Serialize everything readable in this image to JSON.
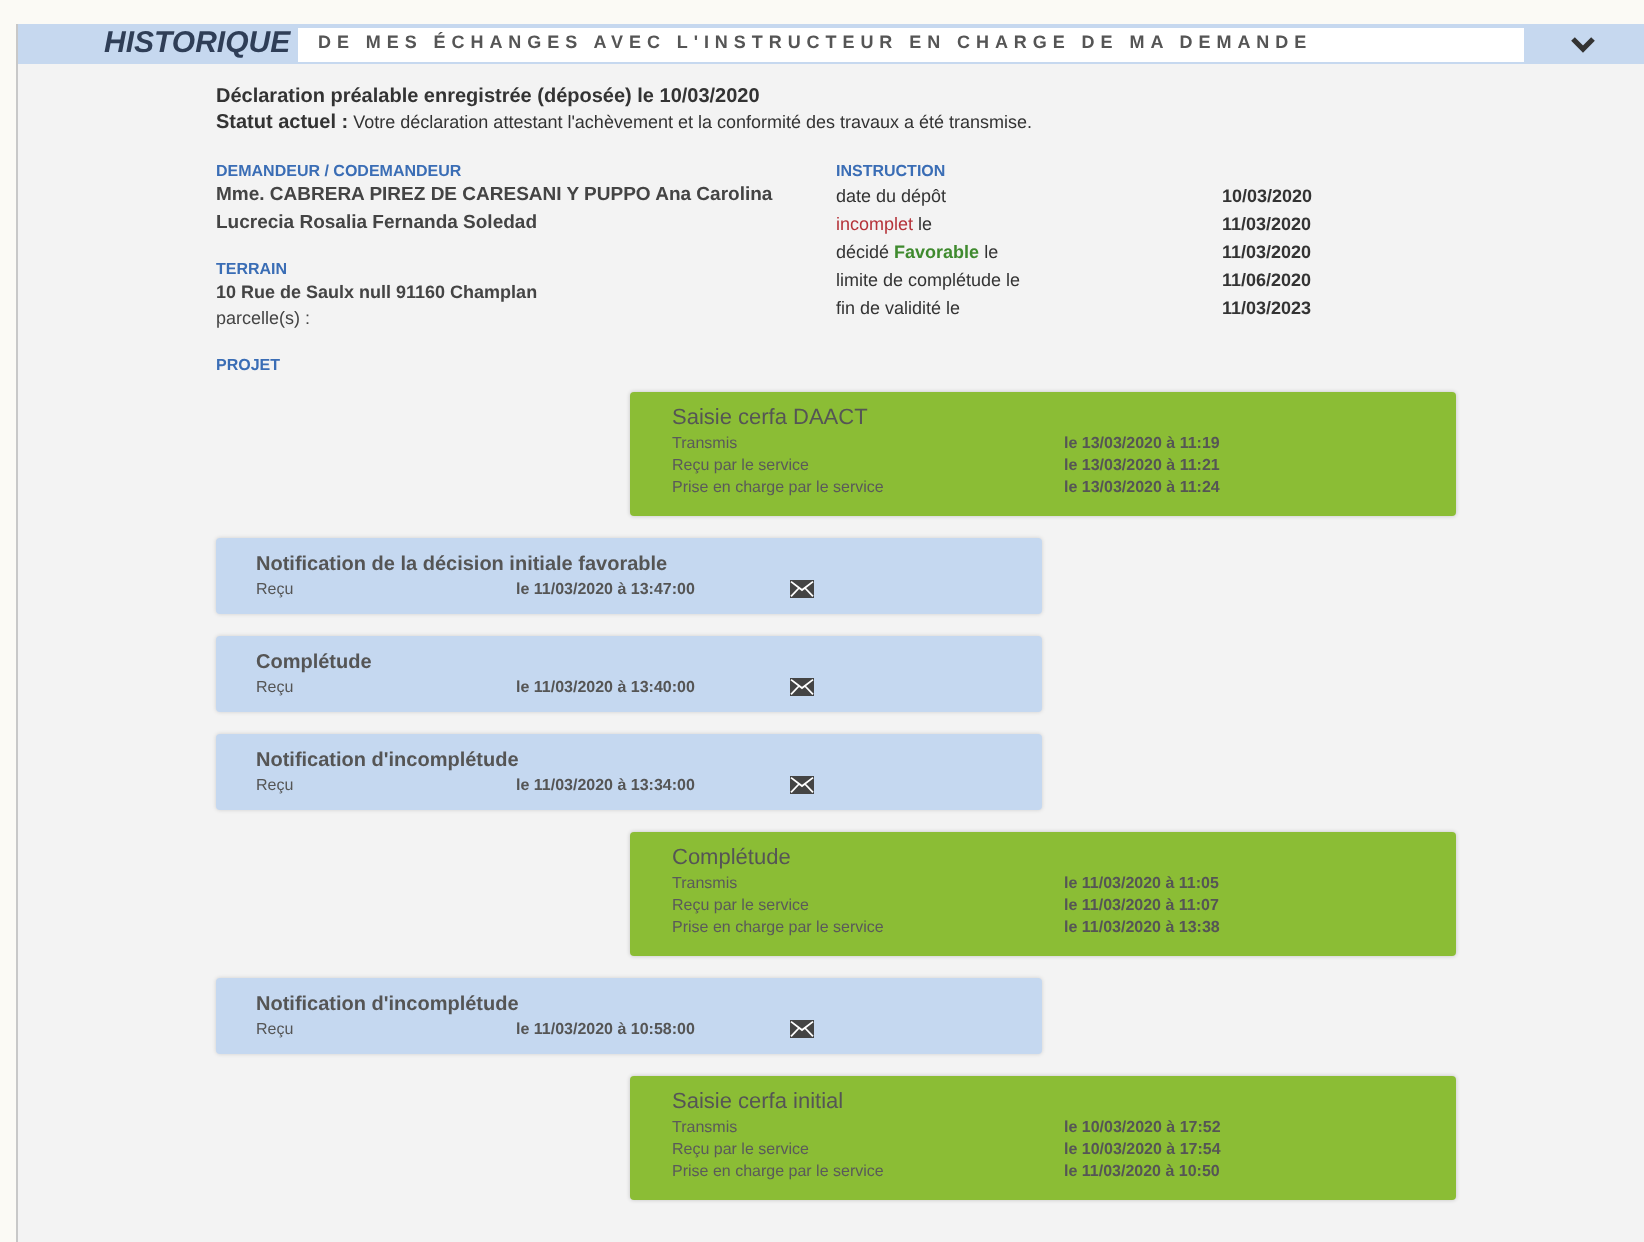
{
  "header": {
    "title": "HISTORIQUE",
    "subtitle": "DE MES ÉCHANGES AVEC L'INSTRUCTEUR EN CHARGE DE MA DEMANDE",
    "expanded": true
  },
  "summary": {
    "declaration": "Déclaration préalable enregistrée (déposée) le 10/03/2020",
    "status_label": "Statut actuel :",
    "status_text": "Votre déclaration attestant l'achèvement et la conformité des travaux a été transmise."
  },
  "applicant": {
    "heading": "DEMANDEUR / CODEMANDEUR",
    "name": "Mme. CABRERA PIREZ DE CARESANI Y PUPPO Ana Carolina Lucrecia Rosalia Fernanda Soledad"
  },
  "land": {
    "heading": "TERRAIN",
    "address": "10 Rue de Saulx null 91160 Champlan",
    "parcels": "parcelle(s) :"
  },
  "project": {
    "heading": "PROJET"
  },
  "instruction": {
    "heading": "INSTRUCTION",
    "rows": [
      {
        "parts": [
          {
            "text": "date du dépôt",
            "kind": "plain"
          }
        ],
        "date": "10/03/2020"
      },
      {
        "parts": [
          {
            "text": "incomplet",
            "kind": "negative"
          },
          {
            "text": " le",
            "kind": "plain"
          }
        ],
        "date": "11/03/2020"
      },
      {
        "parts": [
          {
            "text": "décidé ",
            "kind": "plain"
          },
          {
            "text": "Favorable",
            "kind": "positive"
          },
          {
            "text": " le",
            "kind": "plain"
          }
        ],
        "date": "11/03/2020"
      },
      {
        "parts": [
          {
            "text": "limite de complétude le",
            "kind": "plain"
          }
        ],
        "date": "11/06/2020"
      },
      {
        "parts": [
          {
            "text": "fin de validité le",
            "kind": "plain"
          }
        ],
        "date": "11/03/2023"
      }
    ]
  },
  "timeline": [
    {
      "kind": "sent",
      "title": "Saisie cerfa DAACT",
      "rows": [
        {
          "label": "Transmis",
          "value": "le 13/03/2020 à 11:19"
        },
        {
          "label": "Reçu par le service",
          "value": "le 13/03/2020 à 11:21"
        },
        {
          "label": "Prise en charge par le service",
          "value": "le 13/03/2020 à 11:24"
        }
      ]
    },
    {
      "kind": "received",
      "title": "Notification de la décision initiale favorable",
      "rows": [
        {
          "label": "Reçu",
          "value": "le 11/03/2020 à 13:47:00"
        }
      ]
    },
    {
      "kind": "received",
      "title": "Complétude",
      "rows": [
        {
          "label": "Reçu",
          "value": "le 11/03/2020 à 13:40:00"
        }
      ]
    },
    {
      "kind": "received",
      "title": "Notification d'incomplétude",
      "rows": [
        {
          "label": "Reçu",
          "value": "le 11/03/2020 à 13:34:00"
        }
      ]
    },
    {
      "kind": "sent",
      "title": "Complétude",
      "rows": [
        {
          "label": "Transmis",
          "value": "le 11/03/2020 à 11:05"
        },
        {
          "label": "Reçu par le service",
          "value": "le 11/03/2020 à 11:07"
        },
        {
          "label": "Prise en charge par le service",
          "value": "le 11/03/2020 à 13:38"
        }
      ]
    },
    {
      "kind": "received",
      "title": "Notification d'incomplétude",
      "rows": [
        {
          "label": "Reçu",
          "value": "le 11/03/2020 à 10:58:00"
        }
      ]
    },
    {
      "kind": "sent",
      "title": "Saisie cerfa initial",
      "rows": [
        {
          "label": "Transmis",
          "value": "le 10/03/2020 à 17:52"
        },
        {
          "label": "Reçu par le service",
          "value": "le 10/03/2020 à 17:54"
        },
        {
          "label": "Prise en charge par le service",
          "value": "le 11/03/2020 à 10:50"
        }
      ]
    }
  ]
}
